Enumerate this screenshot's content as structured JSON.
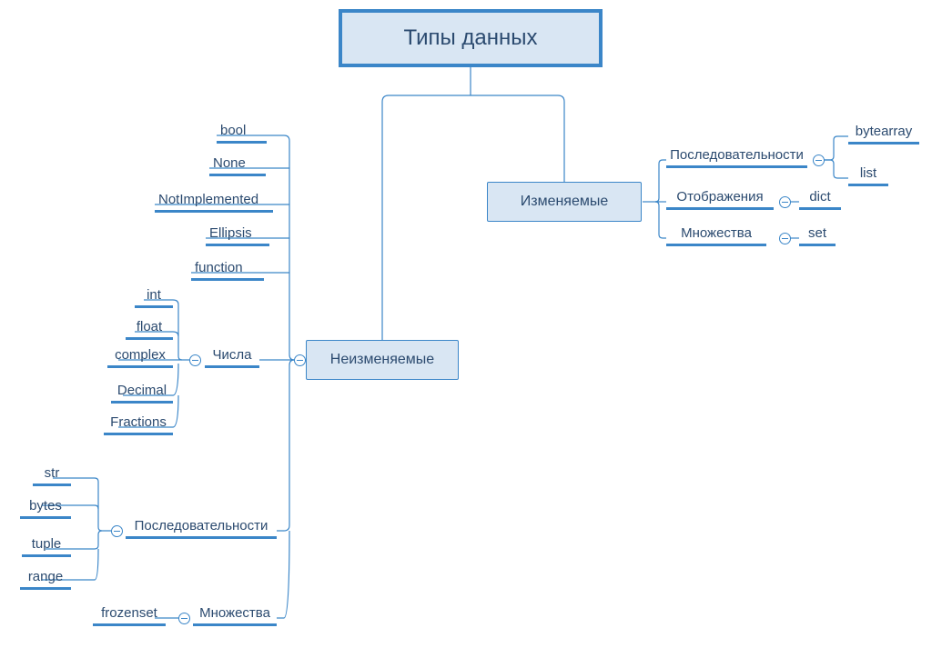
{
  "root": "Типы данных",
  "mutable": {
    "label": "Изменяемые",
    "sequences": {
      "label": "Последовательности",
      "items": [
        "bytearray",
        "list"
      ]
    },
    "mappings": {
      "label": "Отображения",
      "items": [
        "dict"
      ]
    },
    "sets": {
      "label": "Множества",
      "items": [
        "set"
      ]
    }
  },
  "immutable": {
    "label": "Неизменяемые",
    "simple": [
      "bool",
      "None",
      "NotImplemented",
      "Ellipsis",
      "function"
    ],
    "numbers": {
      "label": "Числа",
      "items": [
        "int",
        "float",
        "complex",
        "Decimal",
        "Fractions"
      ]
    },
    "sequences": {
      "label": "Последовательности",
      "items": [
        "str",
        "bytes",
        "tuple",
        "range"
      ]
    },
    "sets": {
      "label": "Множества",
      "items": [
        "frozenset"
      ]
    }
  }
}
